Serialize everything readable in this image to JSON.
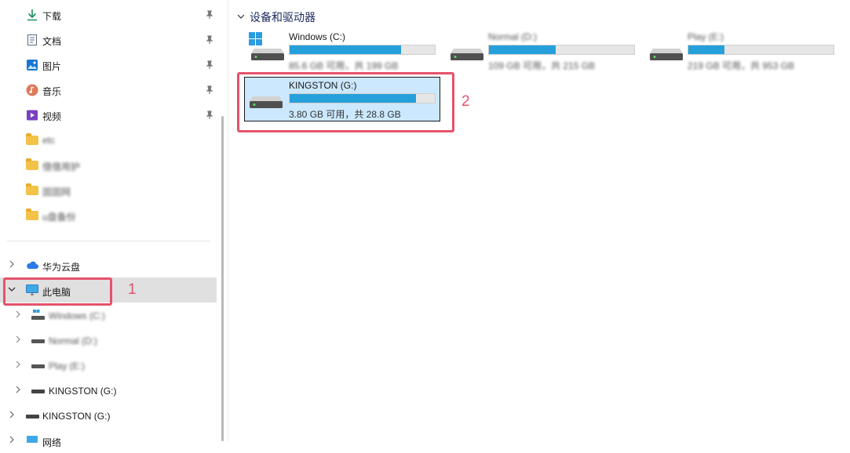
{
  "quick_access": [
    {
      "label": "下载",
      "icon": "download-icon",
      "pinned": true
    },
    {
      "label": "文档",
      "icon": "document-icon",
      "pinned": true
    },
    {
      "label": "图片",
      "icon": "picture-icon",
      "pinned": true
    },
    {
      "label": "音乐",
      "icon": "music-icon",
      "pinned": true
    },
    {
      "label": "视频",
      "icon": "video-icon",
      "pinned": true
    },
    {
      "label": "etc",
      "icon": "folder-icon",
      "blurred": true
    },
    {
      "label": "借借用护",
      "icon": "folder-icon",
      "blurred": true
    },
    {
      "label": "固固网",
      "icon": "folder-icon",
      "blurred": true
    },
    {
      "label": "u盘备份",
      "icon": "folder-icon",
      "blurred": true
    }
  ],
  "tree": {
    "cloud": "华为云盘",
    "this_pc": "此电脑",
    "drives": [
      "Windows (C:)",
      "Normal (D:)",
      "Play (E:)",
      "KINGSTON (G:)"
    ],
    "kingston_root": "KINGSTON (G:)",
    "network": "网络"
  },
  "main": {
    "section_title": "设备和驱动器",
    "drives": [
      {
        "name": "Windows (C:)",
        "info": "85.6 GB 可用，共 199 GB",
        "used_fraction": 0.77
      },
      {
        "name": "Normal (D:)",
        "info": "109 GB 可用，共 215 GB",
        "used_fraction": 0.46
      },
      {
        "name": "Play (E:)",
        "info": "219 GB 可用，共 953 GB",
        "used_fraction": 0.25
      },
      {
        "name": "KINGSTON (G:)",
        "info": "3.80 GB 可用，共 28.8 GB",
        "used_fraction": 0.87,
        "selected": true
      }
    ]
  },
  "annotations": {
    "one": "1",
    "two": "2"
  },
  "colors": {
    "accent": "#26a0da",
    "annotation": "#e5526a",
    "selection": "#cce8ff"
  }
}
